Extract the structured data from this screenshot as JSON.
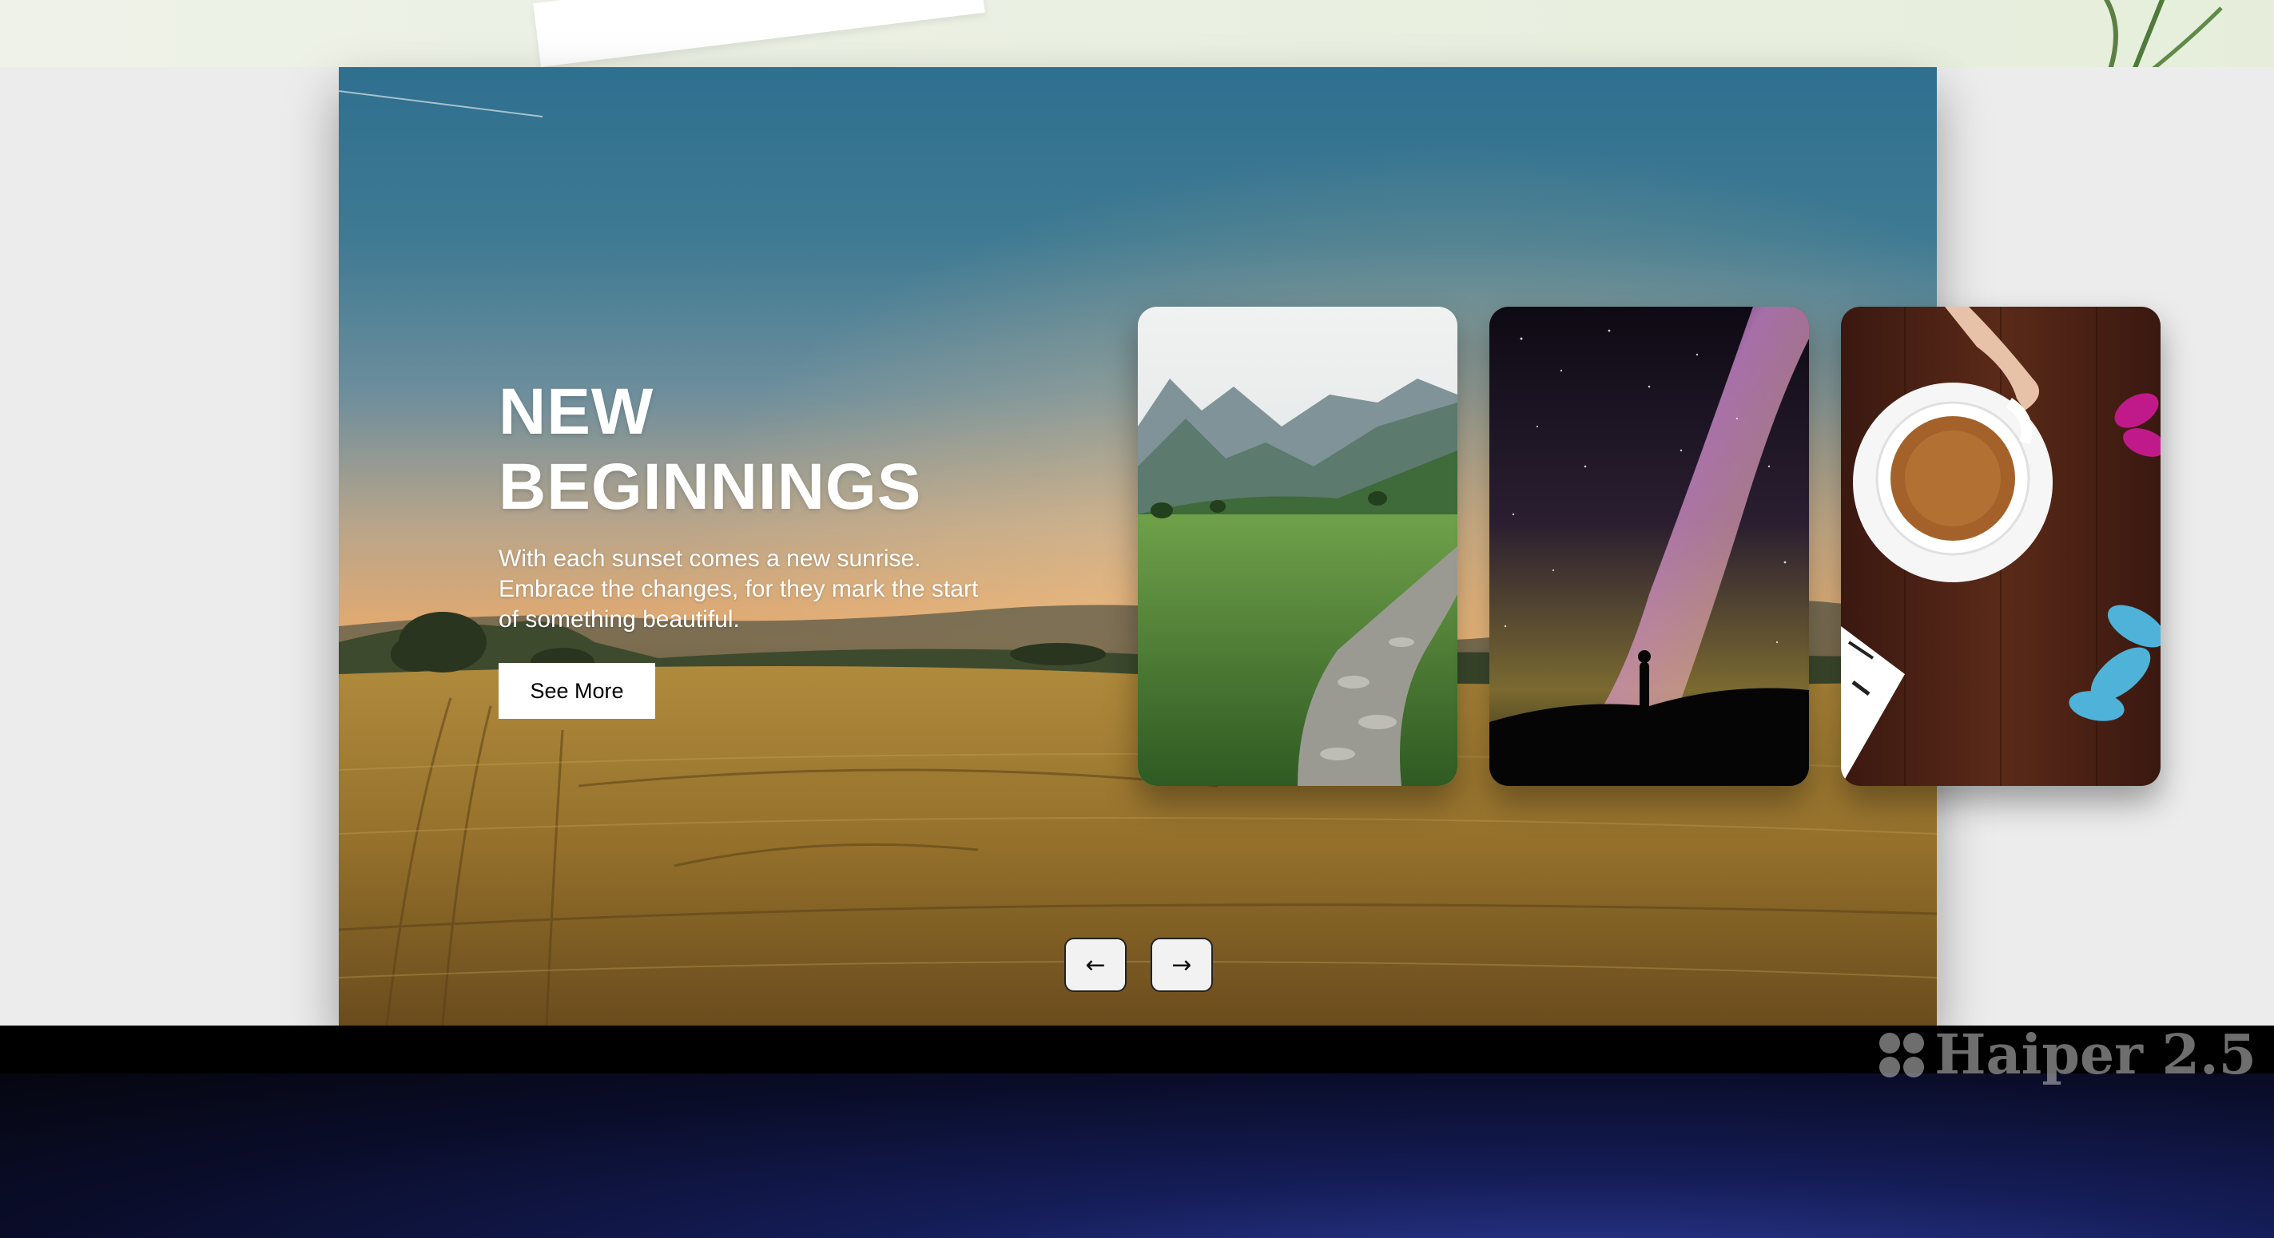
{
  "hero": {
    "title_line1": "NEW",
    "title_line2": "BEGINNINGS",
    "description": "With each sunset comes a new sunrise. Embrace the changes, for they mark the start of something beautiful.",
    "cta_label": "See More"
  },
  "cards": [
    {
      "icon": "mountain-path-image"
    },
    {
      "icon": "milky-way-image"
    },
    {
      "icon": "coffee-flowers-image"
    }
  ],
  "controls": {
    "prev_icon": "←",
    "next_icon": "→"
  },
  "watermark": {
    "text": "Haiper 2.5"
  },
  "colors": {
    "sky_top": "#2f6f8f",
    "sunset": "#e8aa6c",
    "field": "#8a6626",
    "button_bg": "#ffffff"
  }
}
